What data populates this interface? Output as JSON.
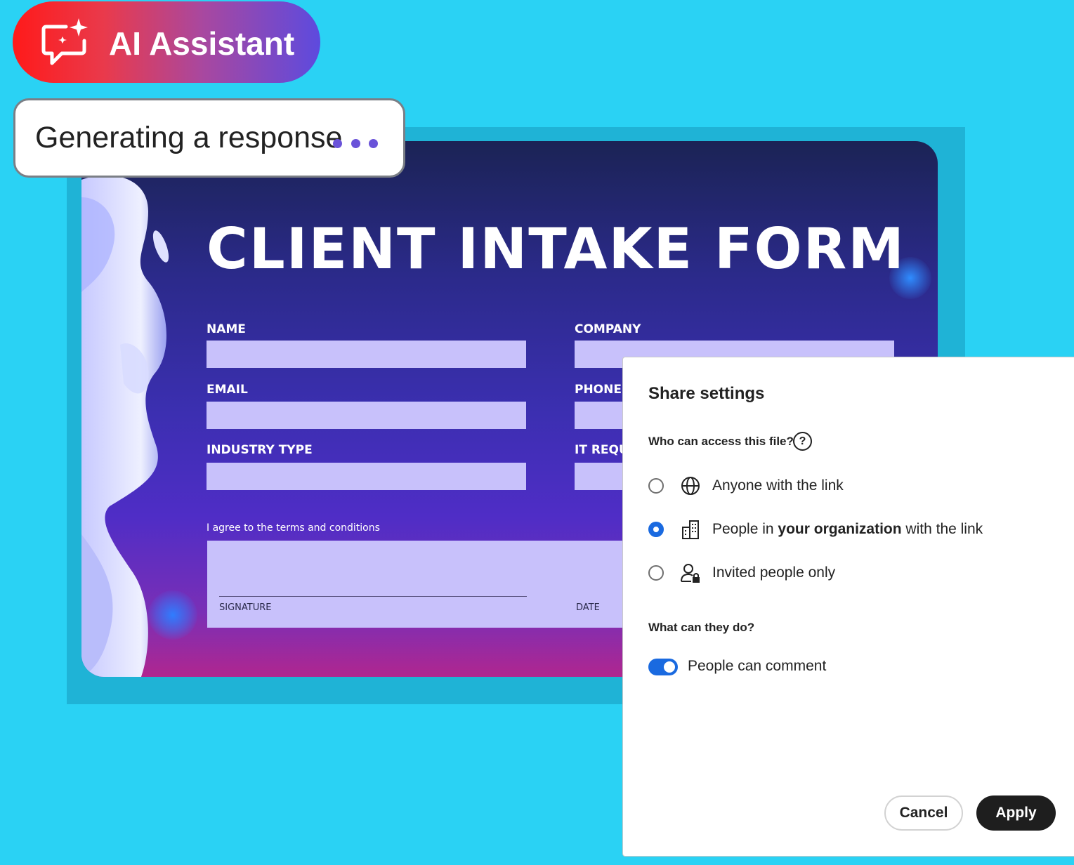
{
  "ai_assistant": {
    "label": "AI Assistant",
    "icon": "ai-chat-sparkle-icon"
  },
  "status": {
    "text": "Generating a response",
    "dot_color": "#6a53d9"
  },
  "form": {
    "title": "CLIENT INTAKE FORM",
    "fields": {
      "name": "NAME",
      "company": "COMPANY",
      "email": "EMAIL",
      "phone": "PHONE",
      "industry": "INDUSTRY TYPE",
      "it_requirements": "IT REQU"
    },
    "terms": "I agree to the terms and conditions",
    "signature": "SIGNATURE",
    "date": "DATE"
  },
  "share": {
    "title": "Share settings",
    "question_access": "Who can access this file?",
    "help_icon": "help-circle-icon",
    "options": {
      "anyone": {
        "label": "Anyone with the link",
        "icon": "globe-icon",
        "selected": false
      },
      "org": {
        "label_pre": "People in ",
        "label_bold": "your organization",
        "label_post": " with the link",
        "icon": "building-icon",
        "selected": true
      },
      "invited": {
        "label": "Invited people only",
        "icon": "user-lock-icon",
        "selected": false
      }
    },
    "question_actions": "What can they do?",
    "toggle": {
      "label": "People can comment",
      "on": true
    },
    "cancel_label": "Cancel",
    "apply_label": "Apply",
    "accent_color": "#1a6ae0"
  }
}
